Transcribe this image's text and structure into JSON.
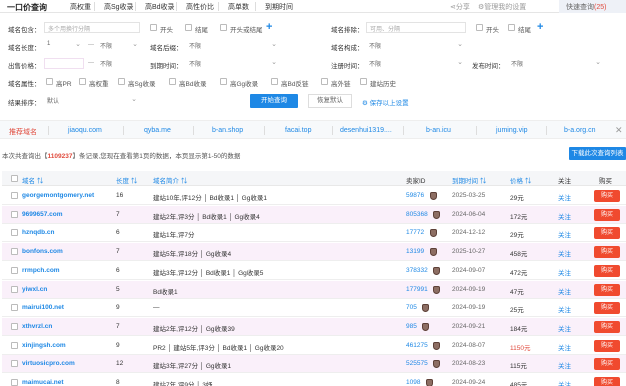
{
  "app": {
    "title": "一口价查询",
    "tabs": [
      "高权重",
      "高Sg收录",
      "高Bd收录",
      "高性价比",
      "高单数",
      "到期时间"
    ],
    "share": "分享",
    "manage": "管理我的设置",
    "quick_query": "快速查询",
    "quick_count": "(25)"
  },
  "filters": {
    "domain_include_label": "域名包含：",
    "domain_include_placeholder": "多个用换行分隔",
    "opening_label": "开头",
    "ending_label": "结尾",
    "open_or_end_label": "开头或结尾",
    "domain_exclude_label": "域名排除：",
    "domain_exclude_placeholder": "可用、分隔",
    "exclude_opening_label": "开头",
    "exclude_ending_label": "结尾",
    "length_label": "域名长度：",
    "length_min": "1",
    "length_max": "不限",
    "suffix_label": "域名后缀：",
    "suffix_value": "不限",
    "structure_label": "域名构成：",
    "structure_value": "不限",
    "sell_price_label": "出售价格：",
    "sell_price_max": "不限",
    "expire_label": "到期时间：",
    "expire_value": "不限",
    "register_label": "注册时间：",
    "register_value": "不限",
    "publish_label": "发布时间：",
    "publish_value": "不限",
    "attr_label": "域名属性：",
    "attrs": [
      "高PR",
      "高权重",
      "高Sg收录",
      "高Bd收录",
      "高Gg收录",
      "高Bd反链",
      "高外链",
      "建站历史"
    ],
    "sort_label": "结果排序：",
    "sort_value": "默认",
    "query_button": "开始查询",
    "reset_button": "恢复默认",
    "save_button": "保存以上设置"
  },
  "reco": {
    "label": "推荐域名",
    "links": [
      "jiaoqu.com",
      "qyba.me",
      "b-an.shop",
      "facai.top",
      "desenhui1319....",
      "b-an.icu",
      "juming.vip",
      "b-a.org.cn"
    ]
  },
  "summary": {
    "prefix": "本次共查询出【",
    "count": "1109237",
    "suffix": "】条记录,您现在查看第1页的数据，本页显示第1-50的数据",
    "download": "下载此次查询列表"
  },
  "table": {
    "headers": {
      "domain": "域名",
      "length": "长度",
      "intro": "域名简介",
      "seller": "卖家ID",
      "expire": "到期时间",
      "price": "价格",
      "follow": "关注",
      "buy": "购买"
    },
    "buy_label": "购买",
    "follow_label": "关注",
    "rows": [
      {
        "domain": "georgemontgomery.net",
        "length": "16",
        "intro": "建站10年,评12分 │ Bd收录1 │ Gg收录1",
        "seller": "59876",
        "expire": "2025-03-25",
        "price": "29元",
        "red": false
      },
      {
        "domain": "9699657.com",
        "length": "7",
        "intro": "建站2年,评3分 │ Bd收录1 │ Gg收录4",
        "seller": "805368",
        "expire": "2024-06-04",
        "price": "172元",
        "red": false
      },
      {
        "domain": "hznqdb.cn",
        "length": "6",
        "intro": "建站1年,评7分",
        "seller": "17772",
        "expire": "2024-12-12",
        "price": "29元",
        "red": false
      },
      {
        "domain": "bonfons.com",
        "length": "7",
        "intro": "建站5年,评18分 │ Gg收录4",
        "seller": "13199",
        "expire": "2025-10-27",
        "price": "458元",
        "red": false
      },
      {
        "domain": "rrmpch.com",
        "length": "6",
        "intro": "建站3年,评12分 │ Bd收录1 │ Gg收录5",
        "seller": "378332",
        "expire": "2024-09-07",
        "price": "472元",
        "red": false
      },
      {
        "domain": "yiwxl.cn",
        "length": "5",
        "intro": "Bd收录1",
        "seller": "177991",
        "expire": "2024-09-19",
        "price": "47元",
        "red": false
      },
      {
        "domain": "mairui100.net",
        "length": "9",
        "intro": "—",
        "seller": "705",
        "expire": "2024-09-19",
        "price": "25元",
        "red": false
      },
      {
        "domain": "xthvrzl.cn",
        "length": "7",
        "intro": "建站2年,评12分 │ Gg收录39",
        "seller": "985",
        "expire": "2024-09-21",
        "price": "184元",
        "red": false
      },
      {
        "domain": "xinjingsh.com",
        "length": "9",
        "intro": "PR2 │ 建站5年,评3分 │ Bd收录1 │ Gg收录20",
        "seller": "461275",
        "expire": "2024-08-07",
        "price": "1150元",
        "red": true
      },
      {
        "domain": "virtuosicpro.com",
        "length": "12",
        "intro": "建站3年,评27分 │ Gg收录1",
        "seller": "525575",
        "expire": "2024-08-23",
        "price": "115元",
        "red": false
      },
      {
        "domain": "maimucai.net",
        "length": "8",
        "intro": "建站7年,评9分 │ 3妤",
        "seller": "1098",
        "expire": "2024-09-24",
        "price": "485元",
        "red": false
      }
    ]
  }
}
